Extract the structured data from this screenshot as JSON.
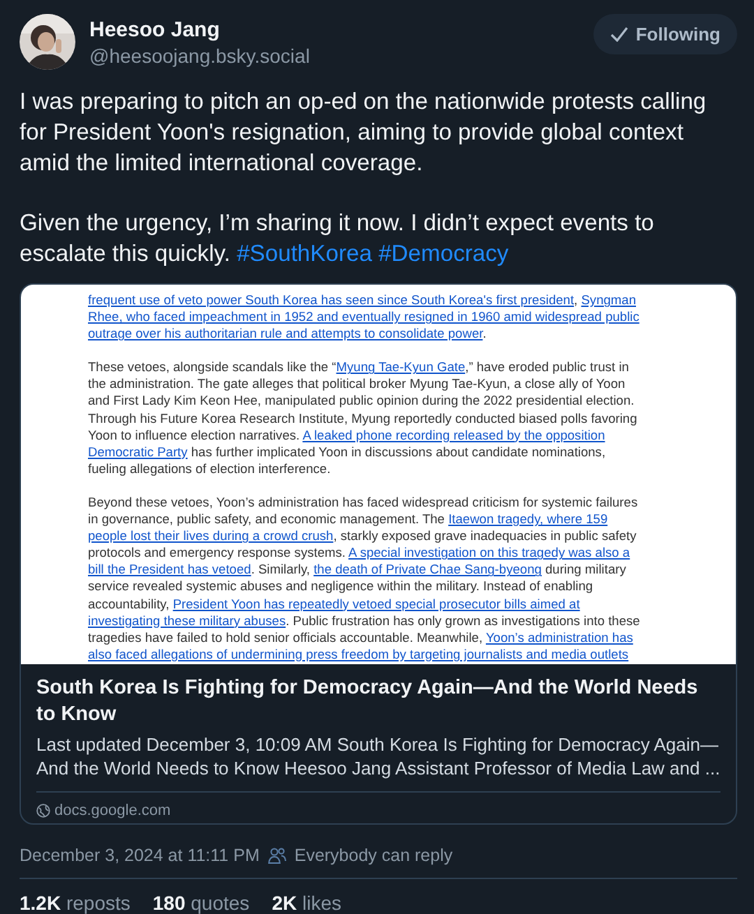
{
  "author": {
    "name": "Heesoo Jang",
    "handle": "@heesoojang.bsky.social"
  },
  "follow_button": {
    "label": "Following",
    "following": true
  },
  "post_text": [
    [
      {
        "text": "I was preparing to pitch an op-ed on the nationwide protests calling for President Yoon's resignation, aiming to provide global context amid the limited international coverage.",
        "link": false
      }
    ],
    [
      {
        "text": "Given the urgency, I’m sharing it now. I didn’t expect events to escalate this quickly. ",
        "link": false
      },
      {
        "text": "#SouthKorea",
        "link": true
      },
      {
        "text": "#Democracy",
        "link": true
      }
    ]
  ],
  "link_card": {
    "document_preview": {
      "paragraphs": [
        {
          "lines": [
            [
              {
                "text": "frequent use of veto power South Korea has seen since South Korea's first president",
                "link": true
              },
              {
                "text": ", ",
                "link": false
              },
              {
                "text": "Syngman",
                "link": true
              }
            ],
            [
              {
                "text": "Rhee, who faced impeachment in 1952 and eventually resigned in 1960 amid widespread public",
                "link": true
              }
            ],
            [
              {
                "text": "outrage over his authoritarian rule and attempts to consolidate power",
                "link": true
              },
              {
                "text": ".",
                "link": false
              }
            ]
          ]
        },
        {
          "lines": [
            [
              {
                "text": "These vetoes, alongside scandals like the “",
                "link": false
              },
              {
                "text": "Myung Tae-Kyun Gate",
                "link": true
              },
              {
                "text": ",” have eroded public trust in",
                "link": false
              }
            ],
            [
              {
                "text": "the administration. The gate alleges that political broker Myung Tae-Kyun, a close ally of Yoon",
                "link": false
              }
            ],
            [
              {
                "text": "and First Lady Kim Keon Hee, manipulated public opinion during the 2022 presidential election.",
                "link": false
              }
            ],
            [
              {
                "text": "Through his Future Korea Research Institute, Myung reportedly conducted biased polls favoring",
                "link": false
              }
            ],
            [
              {
                "text": "Yoon to influence election narratives. ",
                "link": false
              },
              {
                "text": "A leaked phone recording released by the opposition",
                "link": true
              }
            ],
            [
              {
                "text": "Democratic Party",
                "link": true
              },
              {
                "text": " has further implicated Yoon in discussions about candidate nominations,",
                "link": false
              }
            ],
            [
              {
                "text": "fueling allegations of election interference.",
                "link": false
              }
            ]
          ]
        },
        {
          "lines": [
            [
              {
                "text": "Beyond these vetoes, Yoon’s administration has faced widespread criticism for systemic failures",
                "link": false
              }
            ],
            [
              {
                "text": "in governance, public safety, and economic management. The ",
                "link": false
              },
              {
                "text": "Itaewon tragedy, where 159",
                "link": true
              }
            ],
            [
              {
                "text": "people lost their lives during a crowd crush",
                "link": true
              },
              {
                "text": ", starkly exposed grave inadequacies in public safety",
                "link": false
              }
            ],
            [
              {
                "text": "protocols and emergency response systems. ",
                "link": false
              },
              {
                "text": "A special investigation on this tragedy was also a",
                "link": true
              }
            ],
            [
              {
                "text": "bill the President has vetoed",
                "link": true
              },
              {
                "text": ". Similarly, ",
                "link": false
              },
              {
                "text": "the death of Private Chae Sang-byeong",
                "link": true
              },
              {
                "text": " during military",
                "link": false
              }
            ],
            [
              {
                "text": "service revealed systemic abuses and negligence within the military. Instead of enabling",
                "link": false
              }
            ],
            [
              {
                "text": "accountability, ",
                "link": false
              },
              {
                "text": "President Yoon has repeatedly vetoed special prosecutor bills aimed at",
                "link": true
              }
            ],
            [
              {
                "text": "investigating these military abuses",
                "link": true
              },
              {
                "text": ". Public frustration has only grown as investigations into these",
                "link": false
              }
            ],
            [
              {
                "text": "tragedies have failed to hold senior officials accountable. Meanwhile, ",
                "link": false
              },
              {
                "text": "Yoon’s administration has",
                "link": true
              }
            ],
            [
              {
                "text": "also faced allegations of undermining press freedom by targeting journalists and media outlets",
                "link": true
              }
            ]
          ]
        }
      ]
    },
    "title": "South Korea Is Fighting for Democracy Again—And the World Needs to Know",
    "description": "Last updated December 3, 10:09 AM  South Korea Is Fighting for Democracy Again—And the World Needs to Know  Heesoo Jang Assistant Professor of Media Law and ...",
    "domain": "docs.google.com"
  },
  "timestamp": "December 3, 2024 at 11:11 PM",
  "reply_setting": "Everybody can reply",
  "stats": [
    {
      "count": "1.2K",
      "label": "reposts"
    },
    {
      "count": "180",
      "label": "quotes"
    },
    {
      "count": "2K",
      "label": "likes"
    }
  ]
}
